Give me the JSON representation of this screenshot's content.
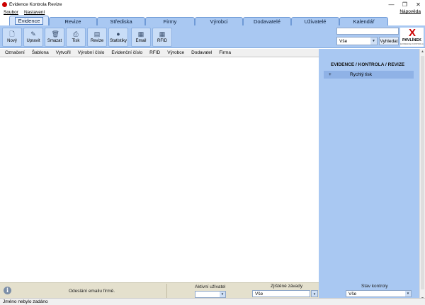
{
  "window": {
    "title": "Evidence Kontrola Revize",
    "minimize": "—",
    "maximize": "❐",
    "close": "✕"
  },
  "menu": {
    "items": [
      "Soubor",
      "Nastavení"
    ],
    "right": "Nápověda"
  },
  "tabs": [
    {
      "label": "Evidence",
      "active": true
    },
    {
      "label": "Revize"
    },
    {
      "label": "Střediska"
    },
    {
      "label": "Firmy"
    },
    {
      "label": "Výrobci"
    },
    {
      "label": "Dodavatelé"
    },
    {
      "label": "Uživatelé"
    },
    {
      "label": "Kalendář"
    }
  ],
  "toolbar": {
    "buttons": [
      {
        "label": "Nový",
        "icon": "new-document-icon",
        "glyph": "🗋"
      },
      {
        "label": "Upravit",
        "icon": "edit-icon",
        "glyph": "✎"
      },
      {
        "label": "Smazat",
        "icon": "delete-icon",
        "glyph": "🗑"
      },
      {
        "label": "Tisk",
        "icon": "printer-icon",
        "glyph": "⎙"
      },
      {
        "label": "Revize",
        "icon": "revision-icon",
        "glyph": "▤"
      },
      {
        "label": "Statistiky",
        "icon": "info-icon",
        "glyph": "●"
      },
      {
        "label": "Email",
        "icon": "email-icon",
        "glyph": "▦"
      },
      {
        "label": "RFID",
        "icon": "rfid-icon",
        "glyph": "▦"
      }
    ],
    "search_value": "",
    "search_scope": "Vše",
    "search_button": "Vyhledat"
  },
  "logo": {
    "mark": "X",
    "name": "PAVLÍNEK",
    "sub": "EVIDENCE KONTROLA"
  },
  "table": {
    "columns": [
      "Označení",
      "Šablona",
      "Vytvořil",
      "Výrobní číslo",
      "Evidenční číslo",
      "RFID",
      "Výrobce",
      "Dodavatel",
      "Firma"
    ],
    "rows": []
  },
  "right_panel": {
    "title": "EVIDENCE / KONTROLA / REVIZE",
    "items": [
      {
        "expander": "+",
        "label": "Rychlý tisk"
      }
    ]
  },
  "bottom": {
    "email_status": "Odeslání emailu firmě.",
    "active_user_label": "Aktivní uživatel",
    "active_user_value": "",
    "fault_label": "Zjištěné závady",
    "fault_value": "Vše",
    "state_label": "Stav kontroly",
    "state_value": "Vše"
  },
  "status": {
    "text": "Jméno nebylo zadáno"
  },
  "colors": {
    "accent": "#a9c8f2",
    "panel": "#8fb2e6",
    "bottom": "#e4e0cd"
  }
}
